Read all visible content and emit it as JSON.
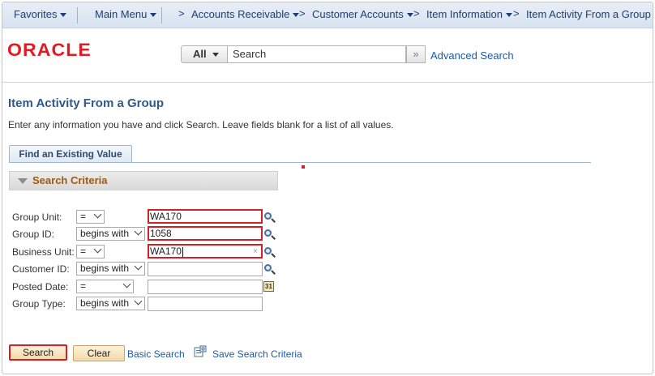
{
  "nav": {
    "favorites": "Favorites",
    "main_menu": "Main Menu",
    "breadcrumb_separator": ">",
    "crumbs": [
      "Accounts Receivable",
      "Customer Accounts",
      "Item Information",
      "Item Activity From a Group"
    ]
  },
  "header": {
    "logo": "ORACLE",
    "search_scope": "All",
    "search_placeholder": "Search",
    "advanced_search": "Advanced Search"
  },
  "page": {
    "title": "Item Activity From a Group",
    "instructions": "Enter any information you have and click Search. Leave fields blank for a list of all values.",
    "tab": "Find an Existing Value",
    "criteria_header": "Search Criteria"
  },
  "criteria": [
    {
      "label": "Group Unit:",
      "operator": "=",
      "value": "WA170"
    },
    {
      "label": "Group ID:",
      "operator": "begins with",
      "value": "1058"
    },
    {
      "label": "Business Unit:",
      "operator": "=",
      "value": "WA170"
    },
    {
      "label": "Customer ID:",
      "operator": "begins with",
      "value": ""
    },
    {
      "label": "Posted Date:",
      "operator": "=",
      "value": ""
    },
    {
      "label": "Group Type:",
      "operator": "begins with",
      "value": ""
    }
  ],
  "actions": {
    "search": "Search",
    "clear": "Clear",
    "basic_search": "Basic Search",
    "save_criteria": "Save Search Criteria"
  },
  "calendar_icon_text": "31",
  "colors": {
    "oracle_red": "#e11b22",
    "link_blue": "#1c5aa6",
    "title_blue": "#2e5a8a",
    "highlight_red": "#d31f26",
    "button_fill": "#f4d9a8"
  }
}
